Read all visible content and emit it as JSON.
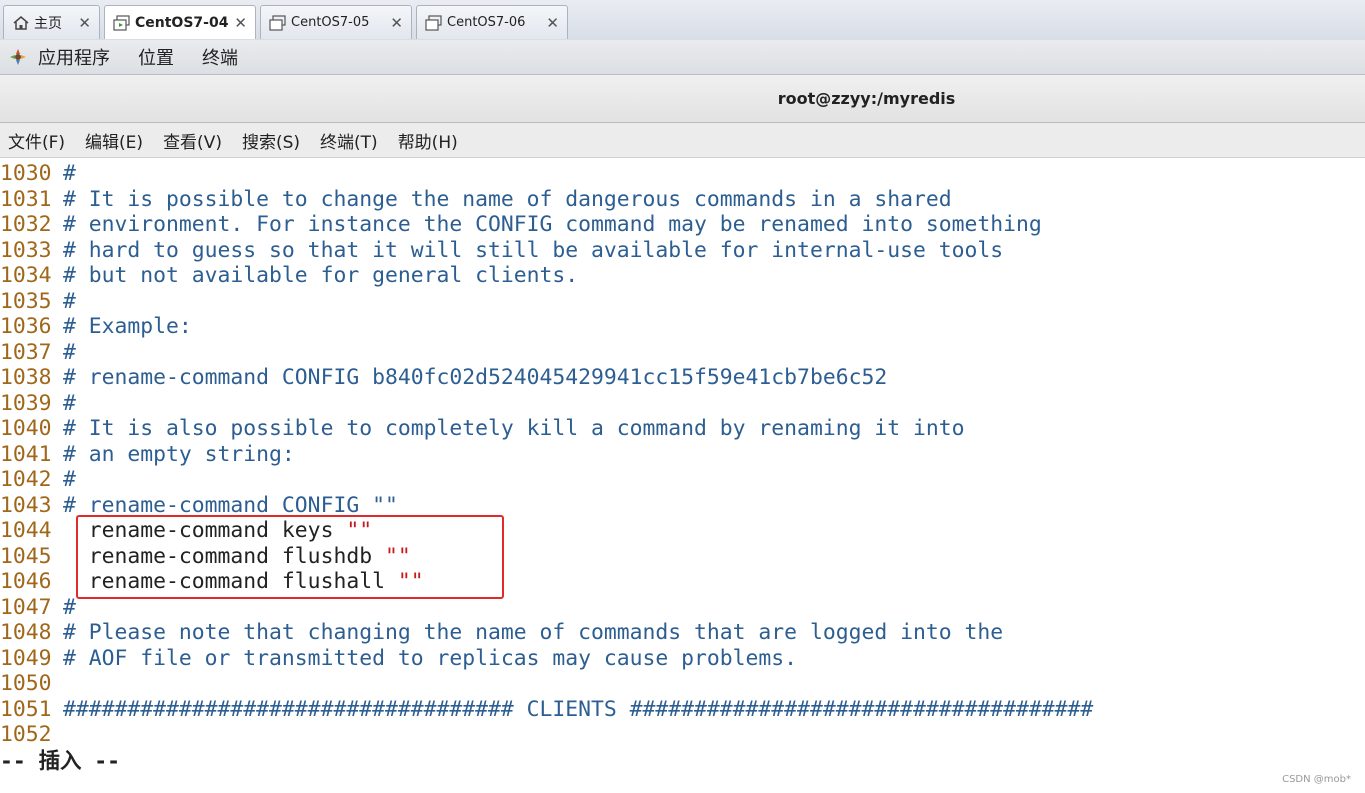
{
  "tabs": [
    {
      "label": "主页",
      "icon": "home-icon",
      "active": false
    },
    {
      "label": "CentOS7-04",
      "icon": "vm-icon",
      "active": true
    },
    {
      "label": "CentOS7-05",
      "icon": "vm-icon",
      "active": false
    },
    {
      "label": "CentOS7-06",
      "icon": "vm-icon",
      "active": false
    }
  ],
  "tab_close_glyph": "✕",
  "gnome_panel": {
    "items": [
      "应用程序",
      "位置",
      "终端"
    ]
  },
  "window": {
    "title": "root@zzyy:/myredis"
  },
  "terminal_menu": {
    "items": [
      "文件(F)",
      "编辑(E)",
      "查看(V)",
      "搜索(S)",
      "终端(T)",
      "帮助(H)"
    ]
  },
  "editor": {
    "lines": [
      {
        "num": "1030",
        "text": "#"
      },
      {
        "num": "1031",
        "text": "# It is possible to change the name of dangerous commands in a shared"
      },
      {
        "num": "1032",
        "text": "# environment. For instance the CONFIG command may be renamed into something"
      },
      {
        "num": "1033",
        "text": "# hard to guess so that it will still be available for internal-use tools"
      },
      {
        "num": "1034",
        "text": "# but not available for general clients."
      },
      {
        "num": "1035",
        "text": "#"
      },
      {
        "num": "1036",
        "text": "# Example:"
      },
      {
        "num": "1037",
        "text": "#"
      },
      {
        "num": "1038",
        "text": "# rename-command CONFIG b840fc02d524045429941cc15f59e41cb7be6c52"
      },
      {
        "num": "1039",
        "text": "#"
      },
      {
        "num": "1040",
        "text": "# It is also possible to completely kill a command by renaming it into"
      },
      {
        "num": "1041",
        "text": "# an empty string:"
      },
      {
        "num": "1042",
        "text": "#"
      },
      {
        "num": "1043",
        "text": "# rename-command CONFIG \"\""
      },
      {
        "num": "1044",
        "text": "  rename-command keys ",
        "str": "\"\""
      },
      {
        "num": "1045",
        "text": "  rename-command flushdb ",
        "str": "\"\""
      },
      {
        "num": "1046",
        "text": "  rename-command flushall ",
        "str": "\"\""
      },
      {
        "num": "1047",
        "text": "#"
      },
      {
        "num": "1048",
        "text": "# Please note that changing the name of commands that are logged into the"
      },
      {
        "num": "1049",
        "text": "# AOF file or transmitted to replicas may cause problems."
      },
      {
        "num": "1050",
        "text": ""
      },
      {
        "num": "1051",
        "text": "################################### CLIENTS ####################################"
      },
      {
        "num": "1052",
        "text": ""
      }
    ],
    "mode_status": "-- 插入 --"
  },
  "watermark": "CSDN @mob*",
  "colors": {
    "line_number": "#a0671a",
    "comment": "#2d5e92",
    "plain_text": "#222222",
    "string": "#c8191a",
    "highlight_border": "#e12b2b"
  }
}
